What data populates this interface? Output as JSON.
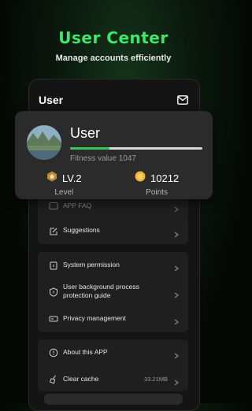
{
  "promo": {
    "title": "User Center",
    "subtitle": "Manage accounts efficiently"
  },
  "header": {
    "title": "User",
    "mail_icon": "mail-icon"
  },
  "user_card": {
    "name": "User",
    "fitness_text": "Fitness value 1047",
    "fitness_progress": 0.3,
    "level_value": "LV.2",
    "level_label": "Level",
    "points_value": "10212",
    "points_label": "Points",
    "accent_color": "#34c759"
  },
  "menu": {
    "group1": [
      {
        "label": "APP FAQ",
        "icon": "faq-icon"
      },
      {
        "label": "Suggestions",
        "icon": "edit-icon"
      }
    ],
    "group2": [
      {
        "label": "System permission",
        "icon": "lock-icon"
      },
      {
        "label": "User background process protection guide",
        "icon": "shield-icon"
      },
      {
        "label": "Privacy management",
        "icon": "privacy-icon"
      }
    ],
    "group3": [
      {
        "label": "About this APP",
        "icon": "info-icon"
      },
      {
        "label": "Clear cache",
        "icon": "broom-icon",
        "value": "33.21MB"
      }
    ]
  },
  "colors": {
    "brand_green": "#3ee86a",
    "card_bg": "#2b2b2b",
    "group_bg": "#1f1f1f"
  }
}
